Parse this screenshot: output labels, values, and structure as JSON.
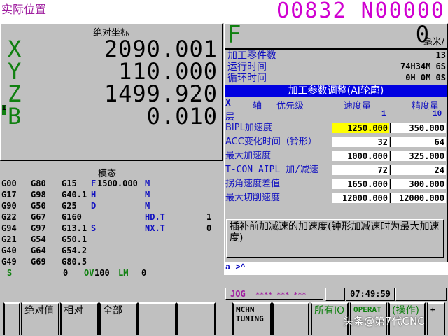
{
  "header": {
    "title": "实际位置",
    "program": "O0832 N00000"
  },
  "position": {
    "title": "绝对坐标",
    "axes": [
      {
        "name": "X",
        "value": "2090.001"
      },
      {
        "name": "Y",
        "value": "110.000"
      },
      {
        "name": "Z",
        "value": "1499.920"
      },
      {
        "name": "B",
        "value": "0.010"
      }
    ],
    "cursor": "I"
  },
  "modal": {
    "title": "模态",
    "rows": [
      [
        "G00",
        "G80",
        "G15",
        "F",
        "1500.000",
        "M",
        "",
        ""
      ],
      [
        "G17",
        "G98",
        "G40.1",
        "H",
        "",
        "M",
        "",
        ""
      ],
      [
        "G90",
        "G50",
        "G25",
        "D",
        "",
        "M",
        "",
        ""
      ],
      [
        "G22",
        "G67",
        "G160",
        "",
        "",
        "HD.T",
        "",
        "1"
      ],
      [
        "G94",
        "G97",
        "G13.1",
        "S",
        "",
        "NX.T",
        "",
        "0"
      ],
      [
        "G21",
        "G54",
        "G50.1",
        "",
        "",
        "",
        "",
        ""
      ],
      [
        "G40",
        "G64",
        "G54.2",
        "",
        "",
        "",
        "",
        ""
      ],
      [
        "G49",
        "G69",
        "G80.5",
        "",
        "",
        "",
        "",
        ""
      ]
    ],
    "footer": {
      "s_label": "S",
      "s_value": "0",
      "ov_label": "OV",
      "ov_value": "100",
      "lm_label": "LM",
      "lm_value": "0"
    }
  },
  "feed": {
    "label": "F",
    "value": "0",
    "unit": "毫米/"
  },
  "counters": [
    {
      "label": "加工零件数",
      "value": "13"
    },
    {
      "label": "运行时间",
      "value": "74H34M 6S"
    },
    {
      "label": "循环时间",
      "value": "0H 0M 0S"
    }
  ],
  "params": {
    "title": "加工参数调整(AI轮廓)",
    "axis_label": "X",
    "axis_col": "轴",
    "priority": "优先级",
    "speed": "速度量",
    "precision": "精度量",
    "layer": "层",
    "speed_layer": "1",
    "precision_layer": "10",
    "rows": [
      {
        "label": "BIPL加速度",
        "speed": "1250.000",
        "precision": "350.000"
      },
      {
        "label": "ACC变化时间（铃形）",
        "speed": "32",
        "precision": "64"
      },
      {
        "label": "最大加速度",
        "speed": "1000.000",
        "precision": "325.000"
      },
      {
        "label": "T-CON AIPL 加/减速",
        "speed": "72",
        "precision": "24"
      },
      {
        "label": "拐角速度差值",
        "speed": "1650.000",
        "precision": "300.000"
      },
      {
        "label": "最大切削速度",
        "speed": "12000.000",
        "precision": "12000.000"
      }
    ],
    "highlight_color": "#ffff00",
    "description": "插补前加减速的加速度(钟形加减速时为最大加速度)"
  },
  "command_line": "a >^",
  "status": {
    "mode": "JOG",
    "stars": "**** *** ***",
    "time": "07:49:59"
  },
  "softkeys_left": [
    "",
    "绝对值",
    "相对",
    "全部",
    "",
    ""
  ],
  "softkeys_right": [
    "MCHN TUNING",
    "",
    "所有IO",
    "OPERAT",
    "(操作)",
    "+"
  ],
  "watermark": "头条@第7代CNC"
}
